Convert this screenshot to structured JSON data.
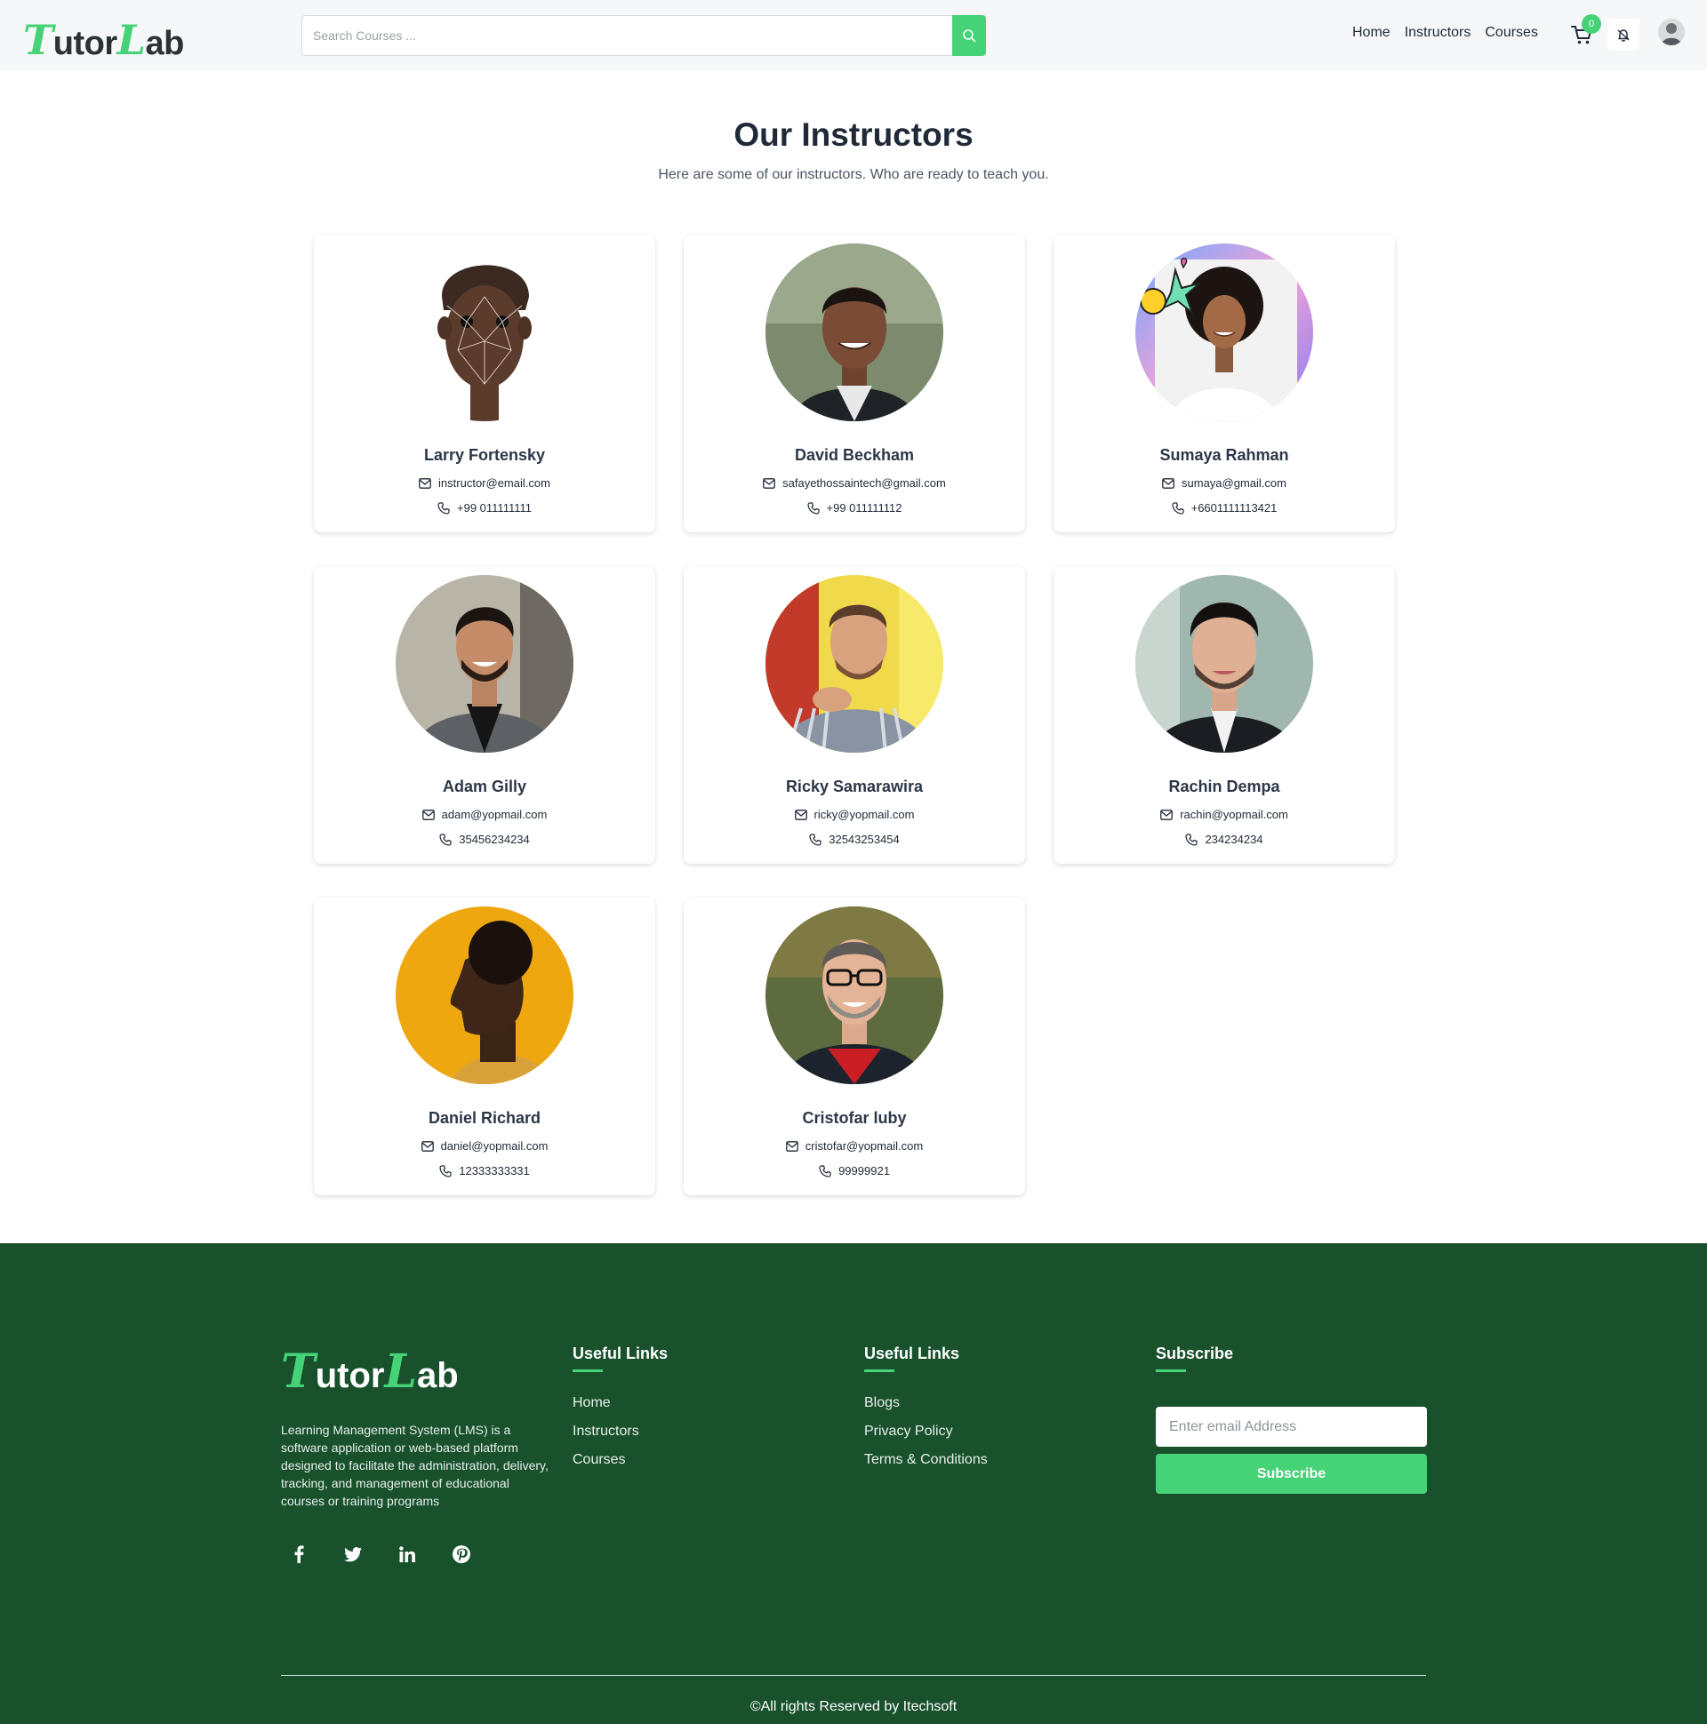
{
  "header": {
    "logo_big": "T",
    "logo_mid": "utor",
    "logo_big2": "L",
    "logo_end": "ab",
    "search_placeholder": "Search Courses ...",
    "nav": [
      "Home",
      "Instructors",
      "Courses"
    ],
    "cart_count": "0"
  },
  "main": {
    "title": "Our Instructors",
    "subtitle": "Here are some of our instructors. Who are ready to teach you."
  },
  "instructors": [
    {
      "name": "Larry Fortensky",
      "email": "instructor@email.com",
      "phone": "+99 011111111"
    },
    {
      "name": "David Beckham",
      "email": "safayethossaintech@gmail.com",
      "phone": "+99 011111112"
    },
    {
      "name": "Sumaya Rahman",
      "email": "sumaya@gmail.com",
      "phone": "+6601111113421"
    },
    {
      "name": "Adam Gilly",
      "email": "adam@yopmail.com",
      "phone": "35456234234"
    },
    {
      "name": "Ricky Samarawira",
      "email": "ricky@yopmail.com",
      "phone": "32543253454"
    },
    {
      "name": "Rachin Dempa",
      "email": "rachin@yopmail.com",
      "phone": "234234234"
    },
    {
      "name": "Daniel Richard",
      "email": "daniel@yopmail.com",
      "phone": "12333333331"
    },
    {
      "name": "Cristofar luby",
      "email": "cristofar@yopmail.com",
      "phone": "99999921"
    }
  ],
  "footer": {
    "description": "Learning Management System (LMS) is a software application or web-based platform designed to facilitate the administration, delivery, tracking, and management of educational courses or training programs",
    "col1": {
      "title": "Useful Links",
      "links": [
        "Home",
        "Instructors",
        "Courses"
      ]
    },
    "col2": {
      "title": "Useful Links",
      "links": [
        "Blogs",
        "Privacy Policy",
        "Terms & Conditions"
      ]
    },
    "subscribe": {
      "title": "Subscribe",
      "placeholder": "Enter email Address",
      "button": "Subscribe"
    },
    "socials": [
      "facebook-icon",
      "twitter-icon",
      "linkedin-icon",
      "pinterest-icon"
    ],
    "copyright": "©All rights Reserved by Itechsoft"
  },
  "colors": {
    "accent": "#46d378",
    "footer_bg": "#19512d"
  }
}
